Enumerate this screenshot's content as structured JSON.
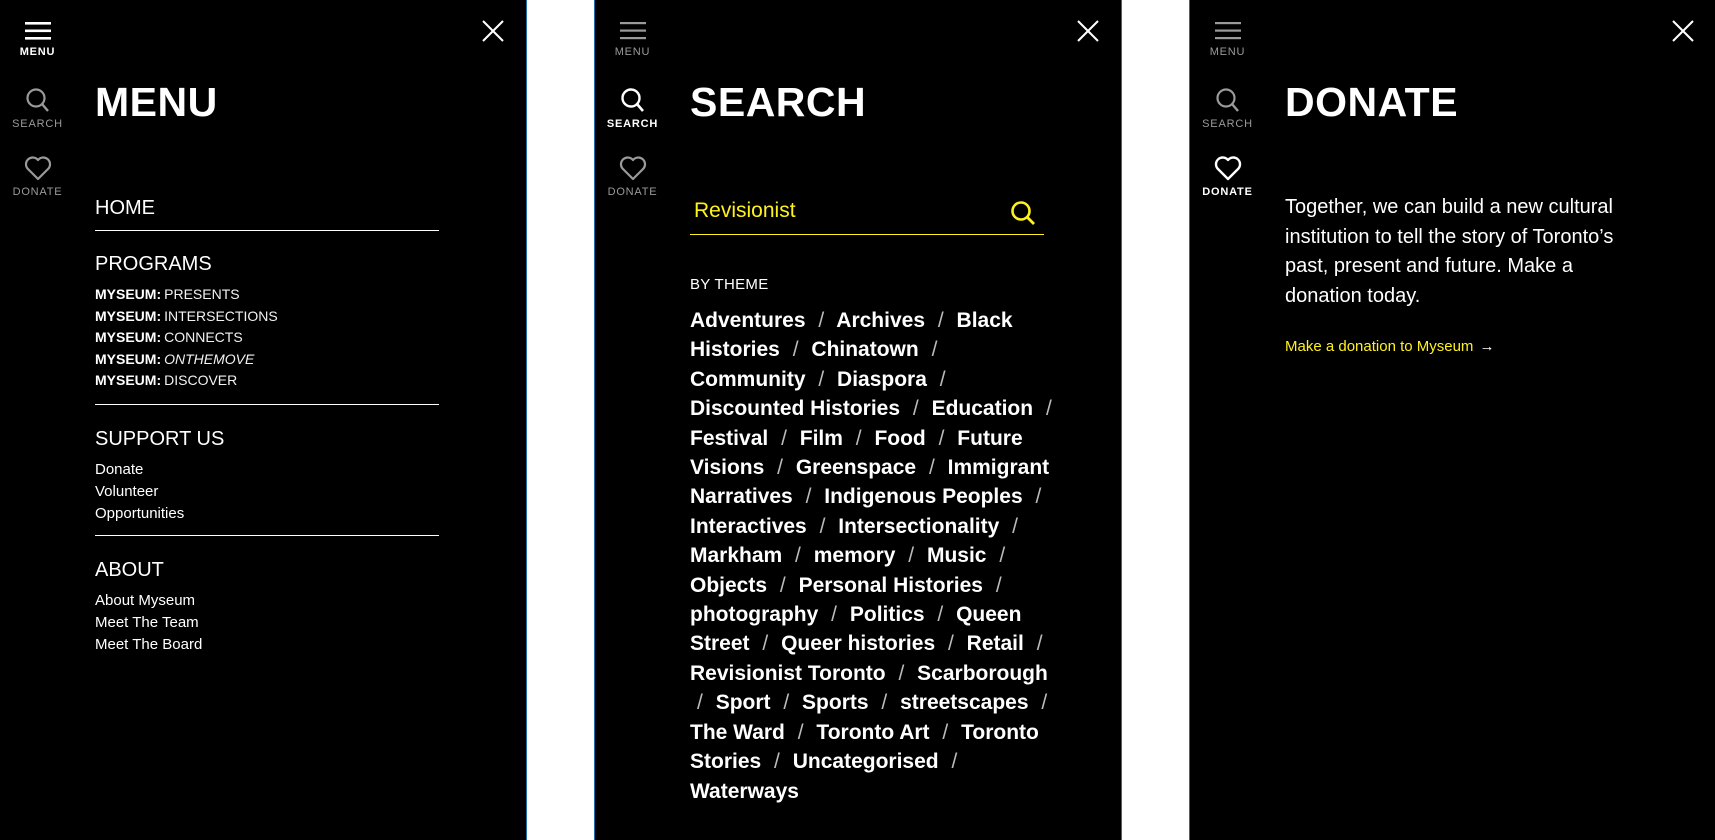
{
  "colors": {
    "accent": "#fff11e",
    "background": "#000000",
    "text": "#ffffff"
  },
  "rail": {
    "menu_label": "MENU",
    "search_label": "SEARCH",
    "donate_label": "DONATE"
  },
  "menu_panel": {
    "title": "MENU",
    "home": "HOME",
    "programs": {
      "heading": "PROGRAMS",
      "items": [
        {
          "prefix": "MYSEUM:",
          "name": "PRESENTS"
        },
        {
          "prefix": "MYSEUM:",
          "name": "INTERSECTIONS"
        },
        {
          "prefix": "MYSEUM:",
          "name": "CONNECTS"
        },
        {
          "prefix": "MYSEUM:",
          "name": "ONTHEMOVE"
        },
        {
          "prefix": "MYSEUM:",
          "name": "DISCOVER"
        }
      ]
    },
    "support": {
      "heading": "SUPPORT US",
      "items": [
        "Donate",
        "Volunteer",
        "Opportunities"
      ]
    },
    "about": {
      "heading": "ABOUT",
      "items": [
        "About Myseum",
        "Meet The Team",
        "Meet The Board"
      ]
    }
  },
  "search_panel": {
    "title": "SEARCH",
    "query": "Revisionist",
    "by_theme_heading": "BY THEME",
    "themes": [
      "Adventures",
      "Archives",
      "Black Histories",
      "Chinatown",
      "Community",
      "Diaspora",
      "Discounted Histories",
      "Education",
      "Festival",
      "Film",
      "Food",
      "Future Visions",
      "Greenspace",
      "Immigrant Narratives",
      "Indigenous Peoples",
      "Interactives",
      "Intersectionality",
      "Markham",
      "memory",
      "Music",
      "Objects",
      "Personal Histories",
      "photography",
      "Politics",
      "Queen Street",
      "Queer histories",
      "Retail",
      "Revisionist Toronto",
      "Scarborough",
      "Sport",
      "Sports",
      "streetscapes",
      "The Ward",
      "Toronto Art",
      "Toronto Stories",
      "Uncategorised",
      "Waterways"
    ],
    "separator": "/"
  },
  "donate_panel": {
    "title": "DONATE",
    "body": "Together, we can build a new cultural institution to tell the story of Toronto’s past, present and future. Make a donation today.",
    "link_label": "Make a donation to Myseum",
    "link_arrow": "→"
  }
}
